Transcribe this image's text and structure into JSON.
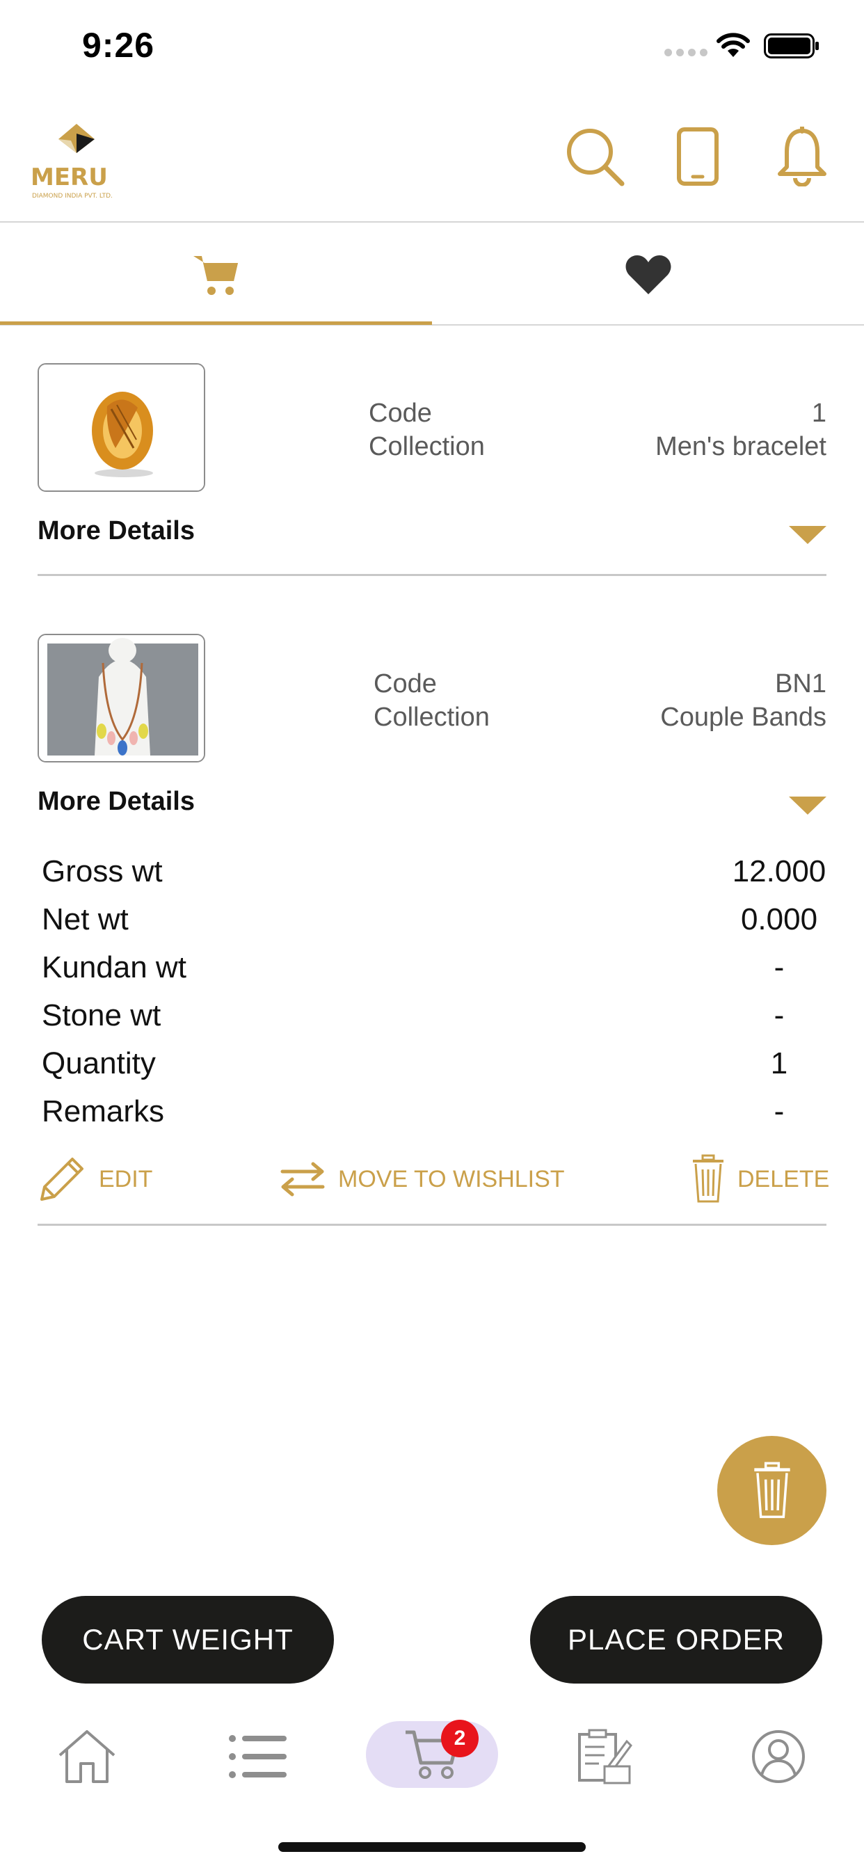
{
  "status_bar": {
    "time": "9:26"
  },
  "header": {
    "logo_text": "MERU",
    "logo_subtext": "DIAMOND INDIA PVT. LTD.",
    "icons": [
      "search-icon",
      "phone-icon",
      "bell-icon"
    ]
  },
  "tabs": [
    {
      "name": "cart",
      "icon": "cart-icon",
      "active": true
    },
    {
      "name": "wishlist",
      "icon": "heart-icon",
      "active": false
    }
  ],
  "colors": {
    "accent": "#caa04a",
    "dark": "#1c1c1a",
    "badge": "#e8141c",
    "active_nav_bg": "#e4ddf5"
  },
  "items": [
    {
      "code_label": "Code",
      "collection_label": "Collection",
      "code": "1",
      "collection": "Men's bracelet",
      "more_details_label": "More Details",
      "expanded": false
    },
    {
      "code_label": "Code",
      "collection_label": "Collection",
      "code": "BN1",
      "collection": "Couple Bands",
      "more_details_label": "More Details",
      "expanded": true,
      "details": [
        {
          "label": "Gross wt",
          "value": "12.000"
        },
        {
          "label": "Net wt",
          "value": "0.000"
        },
        {
          "label": "Kundan wt",
          "value": "-"
        },
        {
          "label": "Stone wt",
          "value": "-"
        },
        {
          "label": "Quantity",
          "value": "1"
        },
        {
          "label": "Remarks",
          "value": "-"
        }
      ],
      "actions": {
        "edit": "EDIT",
        "move": "MOVE TO WISHLIST",
        "delete": "DELETE"
      }
    }
  ],
  "buttons": {
    "cart_weight": "CART WEIGHT",
    "place_order": "PLACE ORDER"
  },
  "bottom_nav": {
    "items": [
      "home-icon",
      "list-icon",
      "cart-icon",
      "order-form-icon",
      "profile-icon"
    ],
    "cart_badge": "2"
  }
}
